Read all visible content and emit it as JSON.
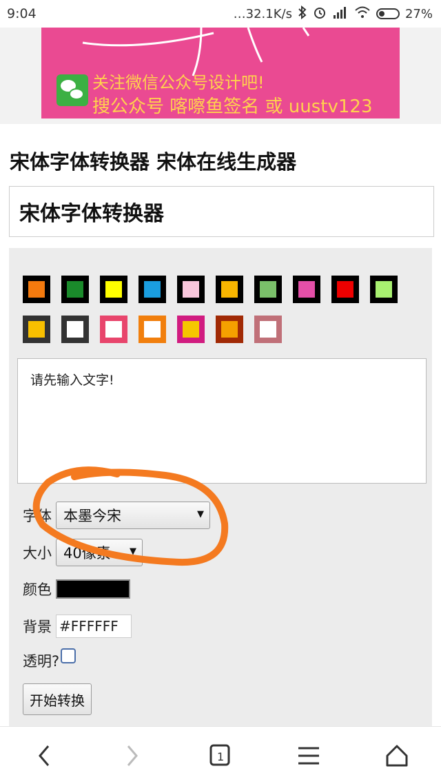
{
  "status_bar": {
    "time": "9:04",
    "network_speed": "…32.1K/s",
    "battery": "27%"
  },
  "banner": {
    "line1": "关注微信公众号设计吧!",
    "line2": "搜公众号 喀嚓鱼签名 或 uustv123",
    "background": "#ea4a92",
    "text_color": "#ffd34d"
  },
  "page": {
    "title": "宋体字体转换器 宋体在线生成器",
    "subtitle": "宋体字体转换器"
  },
  "palette": [
    {
      "border": "#000000",
      "fill": "#f47a0e"
    },
    {
      "border": "#000000",
      "fill": "#1a8a2b"
    },
    {
      "border": "#000000",
      "fill": "#ffff00"
    },
    {
      "border": "#000000",
      "fill": "#1a9ee0"
    },
    {
      "border": "#000000",
      "fill": "#f9c6dc"
    },
    {
      "border": "#000000",
      "fill": "#f7b500"
    },
    {
      "border": "#000000",
      "fill": "#7ac06a"
    },
    {
      "border": "#000000",
      "fill": "#e44fa8"
    },
    {
      "border": "#000000",
      "fill": "#ee0000"
    },
    {
      "border": "#000000",
      "fill": "#a8f070"
    },
    {
      "border": "#333333",
      "fill": "#f8c000"
    },
    {
      "border": "#333333",
      "fill": "#ffffff"
    },
    {
      "border": "#e8456c",
      "fill": "#ffffff"
    },
    {
      "border": "#f17f0d",
      "fill": "#ffffff"
    },
    {
      "border": "#d11c80",
      "fill": "#f6c600"
    },
    {
      "border": "#a12a05",
      "fill": "#f5a000"
    },
    {
      "border": "#c07078",
      "fill": "#ffffff"
    }
  ],
  "form": {
    "text_value": "请先输入文字!",
    "font_label": "字体",
    "font_value": "本墨今宋",
    "size_label": "大小",
    "size_value": "40像素",
    "color_label": "颜色",
    "color_value": "#000000",
    "bg_label": "背景",
    "bg_value": "#FFFFFF",
    "transparent_label": "透明?",
    "submit_label": "开始转换"
  },
  "annotation_color": "#f47a20"
}
